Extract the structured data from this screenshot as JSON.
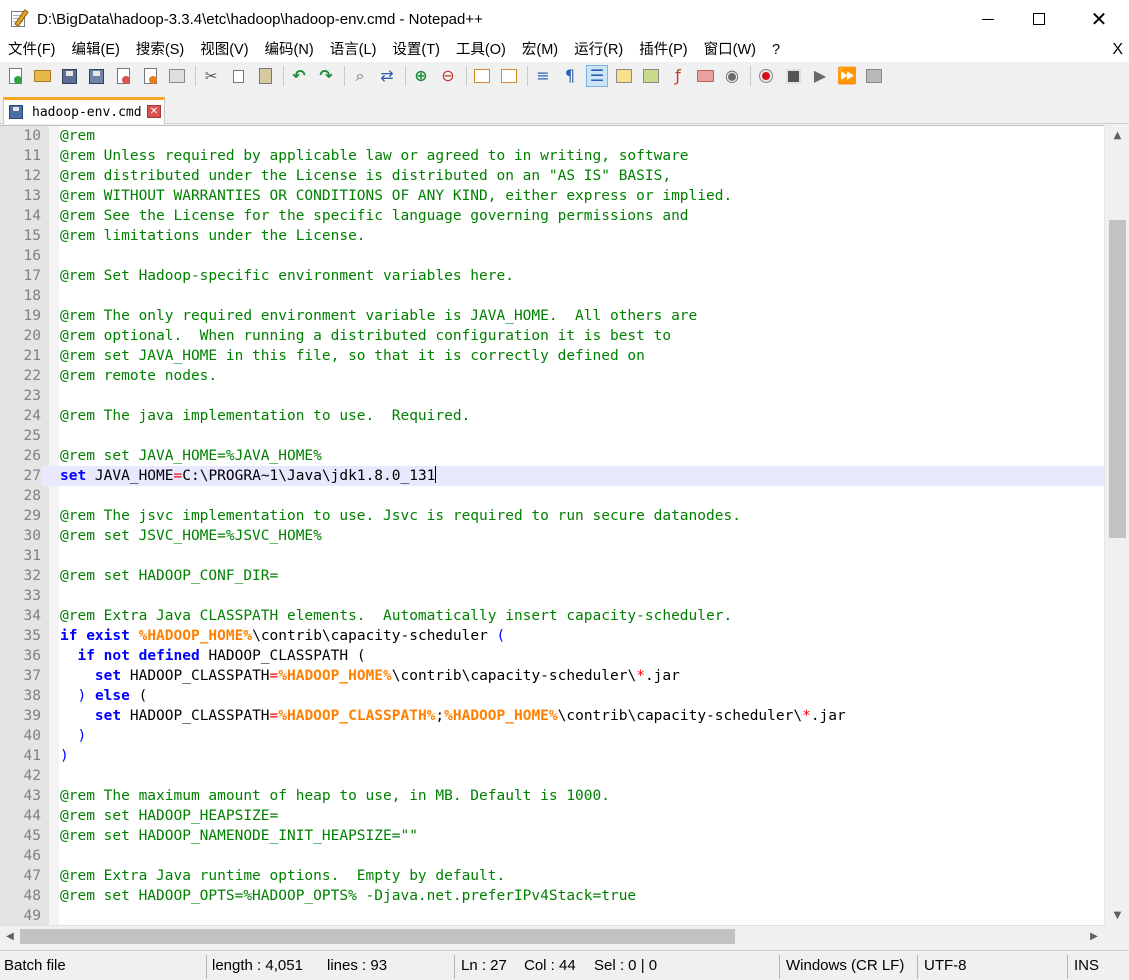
{
  "window": {
    "title": "D:\\BigData\\hadoop-3.3.4\\etc\\hadoop\\hadoop-env.cmd - Notepad++",
    "close_glyph": "✕"
  },
  "menu": {
    "items": [
      "文件(F)",
      "编辑(E)",
      "搜索(S)",
      "视图(V)",
      "编码(N)",
      "语言(L)",
      "设置(T)",
      "工具(O)",
      "宏(M)",
      "运行(R)",
      "插件(P)",
      "窗口(W)",
      "?"
    ],
    "close_label": "X"
  },
  "toolbar": {
    "icons": [
      "new-file-icon",
      "open-file-icon",
      "save-icon",
      "save-all-icon",
      "close-icon",
      "close-all-icon",
      "print-icon",
      "cut-icon",
      "copy-icon",
      "paste-icon",
      "undo-icon",
      "redo-icon",
      "find-icon",
      "replace-icon",
      "zoom-in-icon",
      "zoom-out-icon",
      "sync-vertical-icon",
      "sync-horizontal-icon",
      "word-wrap-icon",
      "show-all-characters-icon",
      "indent-guide-icon",
      "user-defined-language-icon",
      "document-map-icon",
      "function-list-icon",
      "folder-as-workspace-icon",
      "monitoring-icon",
      "record-macro-icon",
      "stop-recording-icon",
      "playback-macro-icon",
      "run-macro-multiple-icon",
      "save-macro-icon"
    ]
  },
  "tab": {
    "label": "hadoop-env.cmd",
    "close_glyph": "✕"
  },
  "editor": {
    "lines": [
      {
        "n": "10",
        "tokens": [
          {
            "t": "@rem",
            "c": "cmt"
          }
        ]
      },
      {
        "n": "11",
        "tokens": [
          {
            "t": "@rem Unless required by applicable law or agreed to in writing, software",
            "c": "cmt"
          }
        ]
      },
      {
        "n": "12",
        "tokens": [
          {
            "t": "@rem distributed under the License is distributed on an \"AS IS\" BASIS,",
            "c": "cmt"
          }
        ]
      },
      {
        "n": "13",
        "tokens": [
          {
            "t": "@rem WITHOUT WARRANTIES OR CONDITIONS OF ANY KIND, either express or implied.",
            "c": "cmt"
          }
        ]
      },
      {
        "n": "14",
        "tokens": [
          {
            "t": "@rem See the License for the specific language governing permissions and",
            "c": "cmt"
          }
        ]
      },
      {
        "n": "15",
        "tokens": [
          {
            "t": "@rem limitations under the License.",
            "c": "cmt"
          }
        ]
      },
      {
        "n": "16",
        "tokens": []
      },
      {
        "n": "17",
        "tokens": [
          {
            "t": "@rem Set Hadoop-specific environment variables here.",
            "c": "cmt"
          }
        ]
      },
      {
        "n": "18",
        "tokens": []
      },
      {
        "n": "19",
        "tokens": [
          {
            "t": "@rem The only required environment variable is JAVA_HOME.  All others are",
            "c": "cmt"
          }
        ]
      },
      {
        "n": "20",
        "tokens": [
          {
            "t": "@rem optional.  When running a distributed configuration it is best to",
            "c": "cmt"
          }
        ]
      },
      {
        "n": "21",
        "tokens": [
          {
            "t": "@rem set JAVA_HOME in this file, so that it is correctly defined on",
            "c": "cmt"
          }
        ]
      },
      {
        "n": "22",
        "tokens": [
          {
            "t": "@rem remote nodes.",
            "c": "cmt"
          }
        ]
      },
      {
        "n": "23",
        "tokens": []
      },
      {
        "n": "24",
        "tokens": [
          {
            "t": "@rem The java implementation to use.  Required.",
            "c": "cmt"
          }
        ]
      },
      {
        "n": "25",
        "tokens": []
      },
      {
        "n": "26",
        "tokens": [
          {
            "t": "@rem set JAVA_HOME=%JAVA_HOME%",
            "c": "cmt"
          }
        ]
      },
      {
        "n": "27",
        "current": true,
        "tokens": [
          {
            "t": "set",
            "c": "kw"
          },
          {
            "t": " JAVA_HOME",
            "c": "txt"
          },
          {
            "t": "=",
            "c": "op"
          },
          {
            "t": "C:\\PROGRA~1\\Java\\jdk1.8.0_131",
            "c": "txt"
          }
        ]
      },
      {
        "n": "28",
        "tokens": []
      },
      {
        "n": "29",
        "tokens": [
          {
            "t": "@rem The jsvc implementation to use. Jsvc is required to run secure datanodes.",
            "c": "cmt"
          }
        ]
      },
      {
        "n": "30",
        "tokens": [
          {
            "t": "@rem set JSVC_HOME=%JSVC_HOME%",
            "c": "cmt"
          }
        ]
      },
      {
        "n": "31",
        "tokens": []
      },
      {
        "n": "32",
        "tokens": [
          {
            "t": "@rem set HADOOP_CONF_DIR=",
            "c": "cmt"
          }
        ]
      },
      {
        "n": "33",
        "tokens": []
      },
      {
        "n": "34",
        "tokens": [
          {
            "t": "@rem Extra Java CLASSPATH elements.  Automatically insert capacity-scheduler.",
            "c": "cmt"
          }
        ]
      },
      {
        "n": "35",
        "tokens": [
          {
            "t": "if",
            "c": "kw"
          },
          {
            "t": " ",
            "c": "txt"
          },
          {
            "t": "exist",
            "c": "kw"
          },
          {
            "t": " ",
            "c": "txt"
          },
          {
            "t": "%HADOOP_HOME%",
            "c": "var"
          },
          {
            "t": "\\contrib\\capacity-scheduler ",
            "c": "txt"
          },
          {
            "t": "(",
            "c": "par"
          }
        ]
      },
      {
        "n": "36",
        "tokens": [
          {
            "t": "  ",
            "c": "txt"
          },
          {
            "t": "if",
            "c": "kw"
          },
          {
            "t": " ",
            "c": "txt"
          },
          {
            "t": "not",
            "c": "kw"
          },
          {
            "t": " ",
            "c": "txt"
          },
          {
            "t": "defined",
            "c": "kw"
          },
          {
            "t": " HADOOP_CLASSPATH (",
            "c": "txt"
          }
        ]
      },
      {
        "n": "37",
        "tokens": [
          {
            "t": "    ",
            "c": "txt"
          },
          {
            "t": "set",
            "c": "kw"
          },
          {
            "t": " HADOOP_CLASSPATH",
            "c": "txt"
          },
          {
            "t": "=",
            "c": "op"
          },
          {
            "t": "%HADOOP_HOME%",
            "c": "var"
          },
          {
            "t": "\\contrib\\capacity-scheduler\\",
            "c": "txt"
          },
          {
            "t": "*",
            "c": "op"
          },
          {
            "t": ".jar",
            "c": "txt"
          }
        ]
      },
      {
        "n": "38",
        "tokens": [
          {
            "t": "  ",
            "c": "txt"
          },
          {
            "t": ")",
            "c": "par"
          },
          {
            "t": " ",
            "c": "txt"
          },
          {
            "t": "else",
            "c": "kw"
          },
          {
            "t": " (",
            "c": "txt"
          }
        ]
      },
      {
        "n": "39",
        "tokens": [
          {
            "t": "    ",
            "c": "txt"
          },
          {
            "t": "set",
            "c": "kw"
          },
          {
            "t": " HADOOP_CLASSPATH",
            "c": "txt"
          },
          {
            "t": "=",
            "c": "op"
          },
          {
            "t": "%HADOOP_CLASSPATH%",
            "c": "var"
          },
          {
            "t": ";",
            "c": "txt"
          },
          {
            "t": "%HADOOP_HOME%",
            "c": "var"
          },
          {
            "t": "\\contrib\\capacity-scheduler\\",
            "c": "txt"
          },
          {
            "t": "*",
            "c": "op"
          },
          {
            "t": ".jar",
            "c": "txt"
          }
        ]
      },
      {
        "n": "40",
        "tokens": [
          {
            "t": "  ",
            "c": "txt"
          },
          {
            "t": ")",
            "c": "par"
          }
        ]
      },
      {
        "n": "41",
        "tokens": [
          {
            "t": ")",
            "c": "par"
          }
        ]
      },
      {
        "n": "42",
        "tokens": []
      },
      {
        "n": "43",
        "tokens": [
          {
            "t": "@rem The maximum amount of heap to use, in MB. Default is 1000.",
            "c": "cmt"
          }
        ]
      },
      {
        "n": "44",
        "tokens": [
          {
            "t": "@rem set HADOOP_HEAPSIZE=",
            "c": "cmt"
          }
        ]
      },
      {
        "n": "45",
        "tokens": [
          {
            "t": "@rem set HADOOP_NAMENODE_INIT_HEAPSIZE=\"\"",
            "c": "cmt"
          }
        ]
      },
      {
        "n": "46",
        "tokens": []
      },
      {
        "n": "47",
        "tokens": [
          {
            "t": "@rem Extra Java runtime options.  Empty by default.",
            "c": "cmt"
          }
        ]
      },
      {
        "n": "48",
        "tokens": [
          {
            "t": "@rem set HADOOP_OPTS=%HADOOP_OPTS% -Djava.net.preferIPv4Stack=true",
            "c": "cmt"
          }
        ]
      },
      {
        "n": "49",
        "tokens": []
      }
    ]
  },
  "scrollbar": {
    "up_glyph": "▲",
    "down_glyph": "▼",
    "left_glyph": "◀",
    "right_glyph": "▶"
  },
  "status": {
    "file_type": "Batch file",
    "length": "length : 4,051",
    "lines": "lines : 93",
    "ln": "Ln : 27",
    "col": "Col : 44",
    "sel": "Sel : 0 | 0",
    "eol": "Windows (CR LF)",
    "encoding": "UTF-8",
    "mode": "INS"
  },
  "colors": {
    "comment": "#008000",
    "keyword": "#0000ff",
    "variable": "#ff8000",
    "operator": "#ff0000",
    "current_line": "#e8e8ff",
    "tab_accent": "#f5a623"
  }
}
